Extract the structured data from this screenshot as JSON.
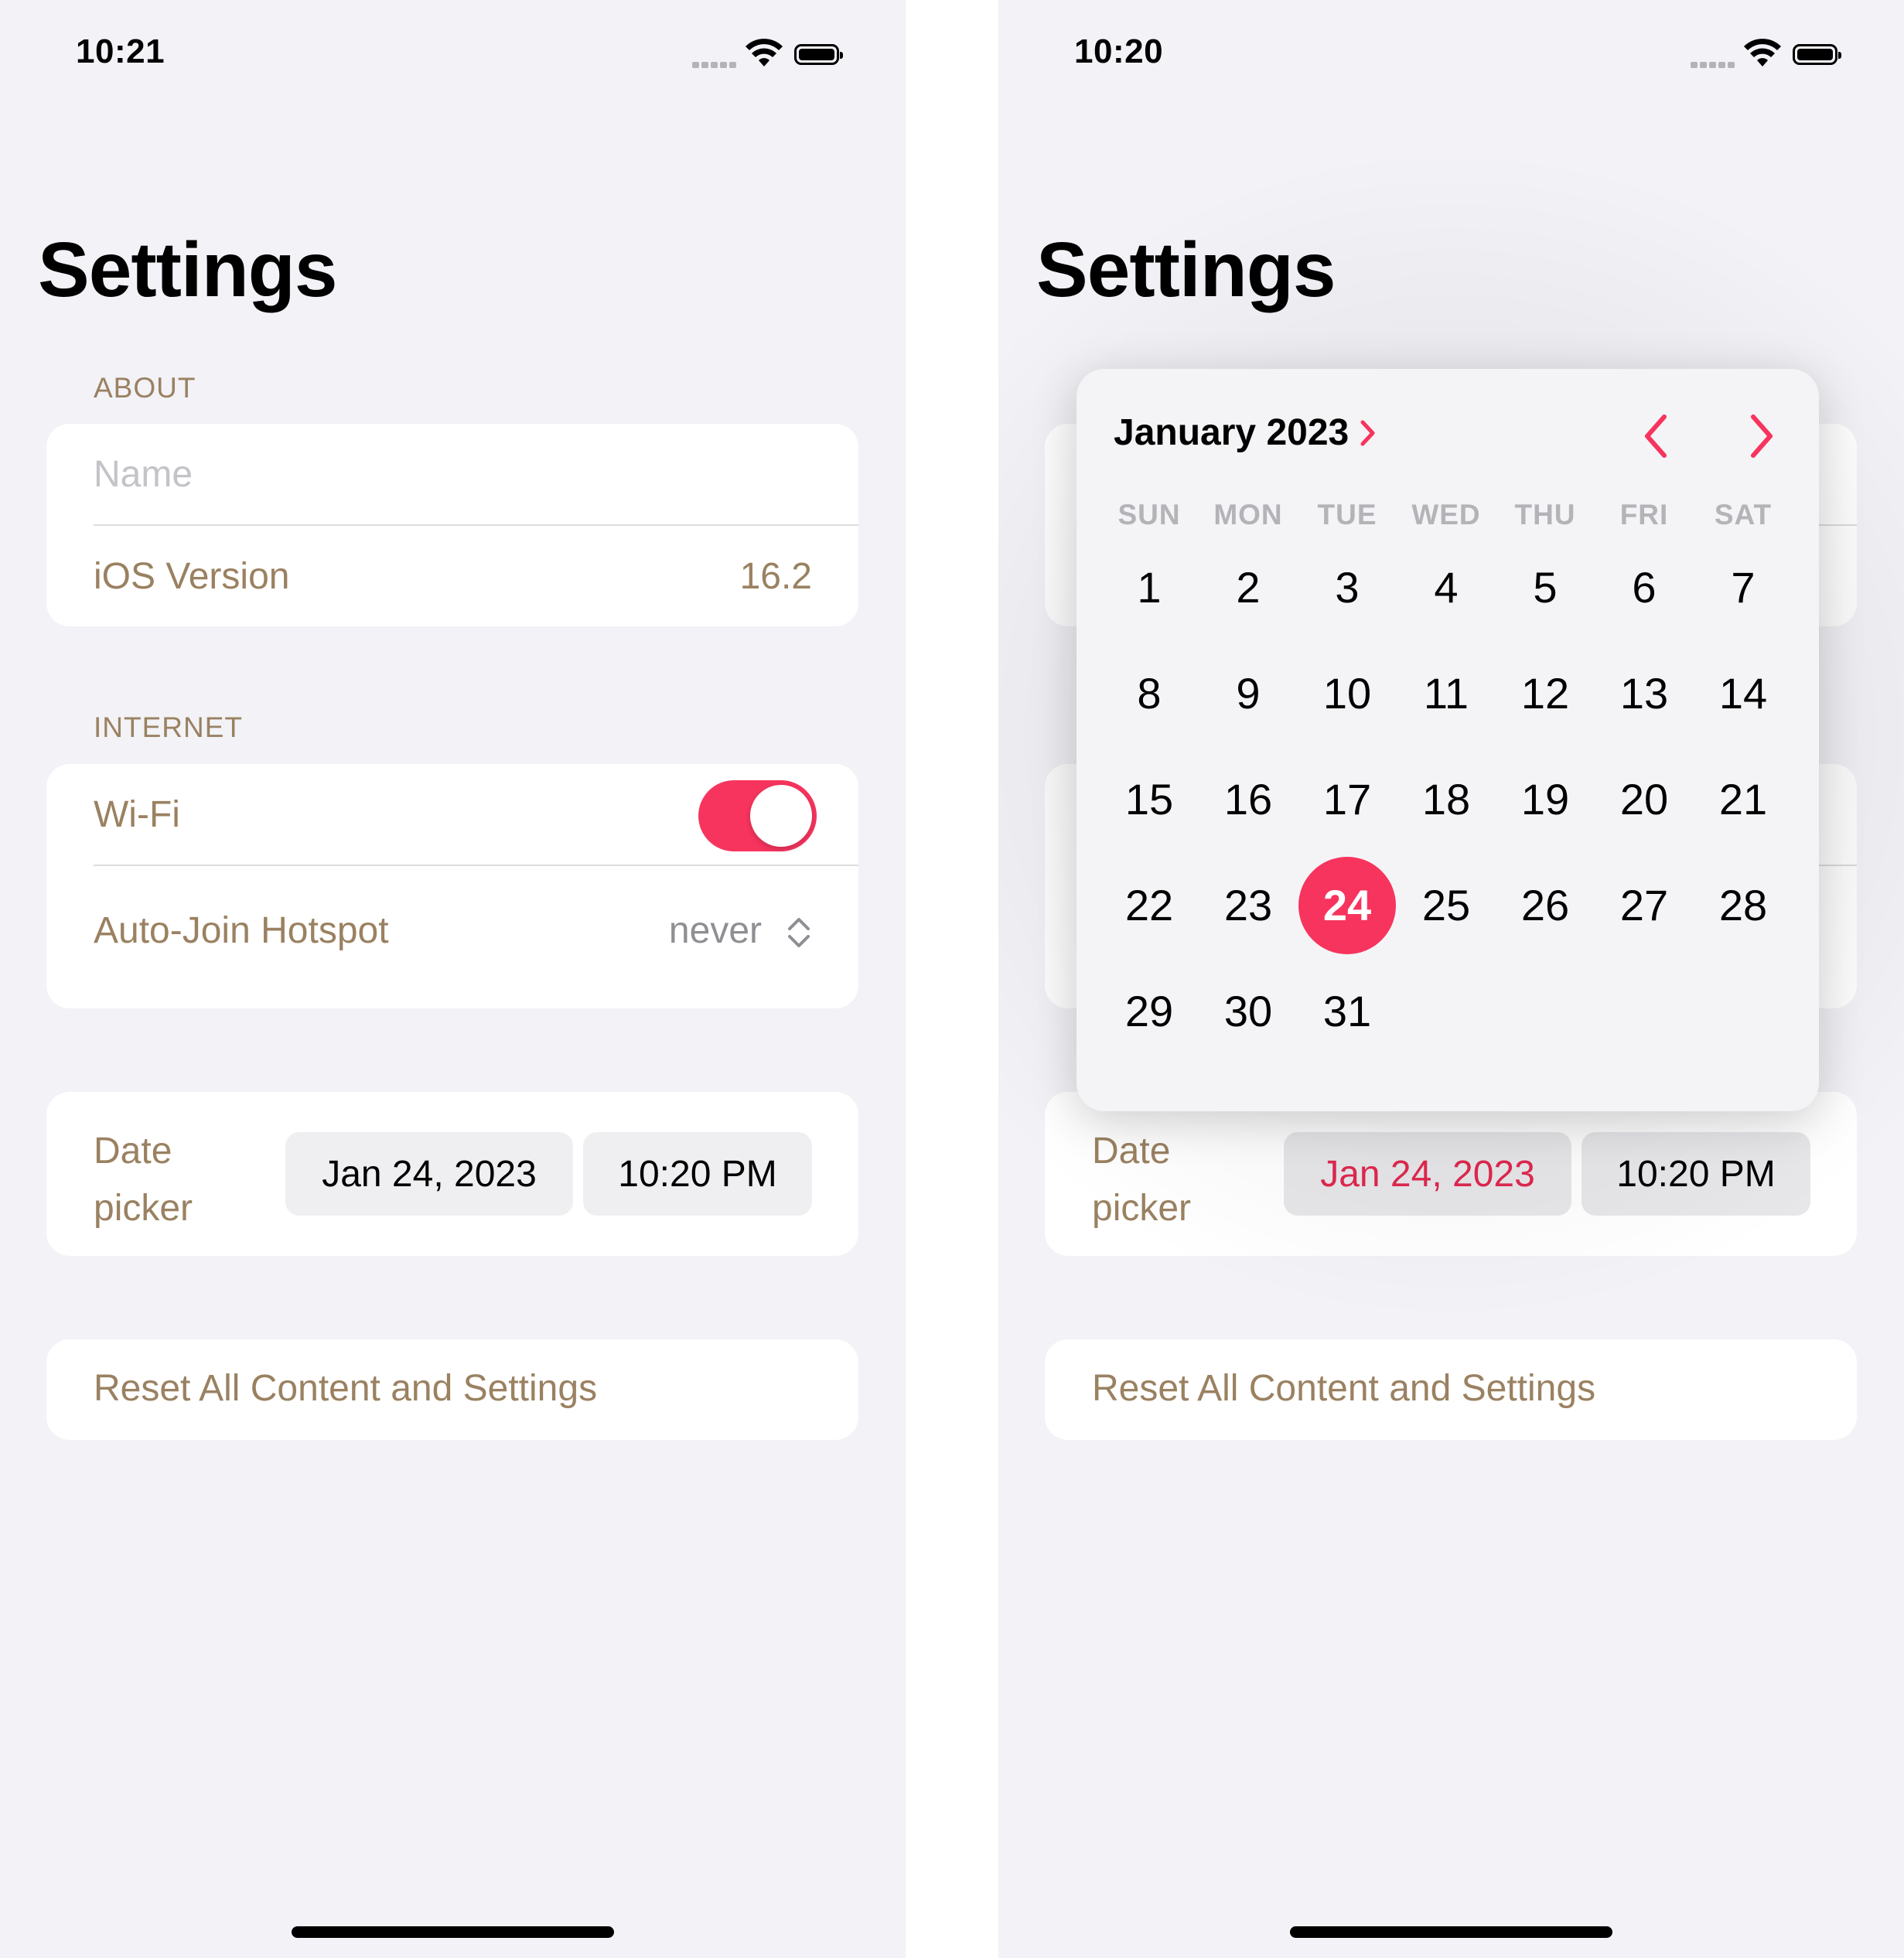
{
  "left": {
    "status_time": "10:21",
    "title": "Settings",
    "about_header": "ABOUT",
    "name_placeholder": "Name",
    "ios_version_label": "iOS Version",
    "ios_version_value": "16.2",
    "internet_header": "INTERNET",
    "wifi_label": "Wi-Fi",
    "wifi_enabled": true,
    "hotspot_label": "Auto-Join Hotspot",
    "hotspot_value": "never",
    "date_label_line1": "Date",
    "date_label_line2": "picker",
    "date_value": "Jan 24, 2023",
    "time_value": "10:20 PM",
    "reset_label": "Reset All Content and Settings"
  },
  "right": {
    "status_time": "10:20",
    "title": "Settings",
    "date_label_line1": "Date",
    "date_label_line2": "picker",
    "date_value": "Jan 24, 2023",
    "time_value": "10:20 PM",
    "reset_label": "Reset All Content and Settings",
    "calendar": {
      "month_label": "January 2023",
      "weekdays": [
        "SUN",
        "MON",
        "TUE",
        "WED",
        "THU",
        "FRI",
        "SAT"
      ],
      "first_weekday_index": 0,
      "days_in_month": 31,
      "selected_day": 24
    }
  },
  "colors": {
    "accent": "#f7345e",
    "label": "#9a8161",
    "background": "#f2f2f7"
  },
  "icons": {
    "signal": "cellular-signal-icon",
    "wifi": "wifi-icon",
    "battery": "battery-icon",
    "stepper": "chevron-up-down-icon",
    "month_chevron": "chevron-right-icon",
    "prev": "chevron-left-icon",
    "next": "chevron-right-icon"
  }
}
